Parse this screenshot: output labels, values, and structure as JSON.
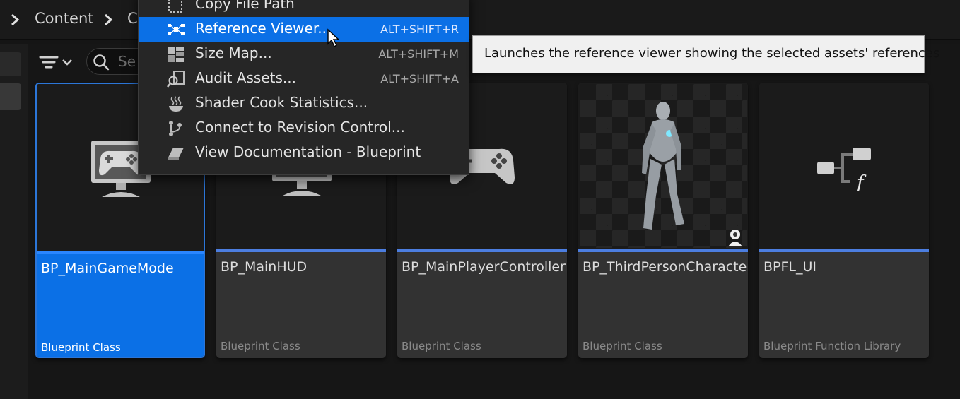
{
  "breadcrumb": {
    "items": [
      {
        "label": "Content"
      },
      {
        "label": "C"
      }
    ]
  },
  "search": {
    "placeholder": "Se"
  },
  "context_menu": {
    "items": [
      {
        "label": "Copy File Path",
        "shortcut": "",
        "icon": "copy-path-icon"
      },
      {
        "label": "Reference Viewer...",
        "shortcut": "ALT+SHIFT+R",
        "icon": "reference-viewer-icon",
        "highlighted": true
      },
      {
        "label": "Size Map...",
        "shortcut": "ALT+SHIFT+M",
        "icon": "size-map-icon"
      },
      {
        "label": "Audit Assets...",
        "shortcut": "ALT+SHIFT+A",
        "icon": "audit-icon"
      },
      {
        "label": "Shader Cook Statistics...",
        "shortcut": "",
        "icon": "shader-stats-icon"
      },
      {
        "label": "Connect to Revision Control...",
        "shortcut": "",
        "icon": "revision-control-icon"
      },
      {
        "label": "View Documentation - Blueprint",
        "shortcut": "",
        "icon": "documentation-icon"
      }
    ]
  },
  "tooltip": {
    "text": "Launches the reference viewer showing the selected assets' references"
  },
  "assets": [
    {
      "name": "BP_MainGameMode",
      "type": "Blueprint Class",
      "icon": "gamemode-monitor-icon",
      "selected": true
    },
    {
      "name": "BP_MainHUD",
      "type": "Blueprint Class",
      "icon": "hud-monitor-icon"
    },
    {
      "name": "BP_MainPlayerController",
      "type": "Blueprint Class",
      "icon": "gamepad-icon"
    },
    {
      "name": "BP_ThirdPersonCharacter",
      "type": "Blueprint Class",
      "icon": "character-mannequin-icon"
    },
    {
      "name": "BPFL_UI",
      "type": "Blueprint Function Library",
      "icon": "function-library-icon"
    }
  ],
  "colors": {
    "selection": "#0b70e6",
    "asset_bar": "#4c7ee0",
    "menu_bg": "#262626"
  }
}
